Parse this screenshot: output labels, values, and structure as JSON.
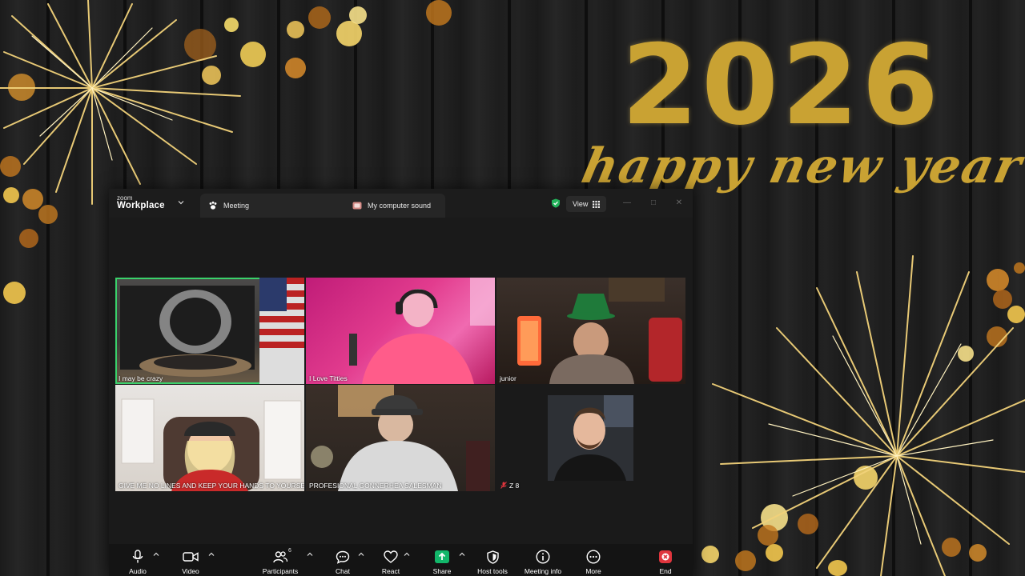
{
  "wallpaper": {
    "year": "2026",
    "greeting": "happy new year",
    "gold": "#c9a233"
  },
  "titlebar": {
    "brand_small": "zoom",
    "brand_large": "Workplace",
    "meeting_tab": "Meeting",
    "sound_tab": "My computer sound",
    "view_label": "View"
  },
  "participants": [
    {
      "name": "I may be crazy",
      "speaking": true
    },
    {
      "name": "I Love Titties",
      "speaking": false
    },
    {
      "name": "junior",
      "speaking": false
    },
    {
      "name": "GIVE ME NO LINES AND KEEP YOUR HANDS TO YOURSELF",
      "speaking": false
    },
    {
      "name": "PROFESIONAL GONNERHEA SALESMAN",
      "speaking": false
    },
    {
      "name": "Z 8",
      "speaking": false,
      "muted": true
    }
  ],
  "controls": {
    "audio": "Audio",
    "video": "Video",
    "participants": "Participants",
    "participant_count": "6",
    "chat": "Chat",
    "react": "React",
    "share": "Share",
    "host_tools": "Host tools",
    "meeting_info": "Meeting info",
    "more": "More",
    "end": "End"
  },
  "colors": {
    "speaker_outline": "#3ad16b",
    "share_green": "#12b76a",
    "end_red": "#e0353d"
  }
}
